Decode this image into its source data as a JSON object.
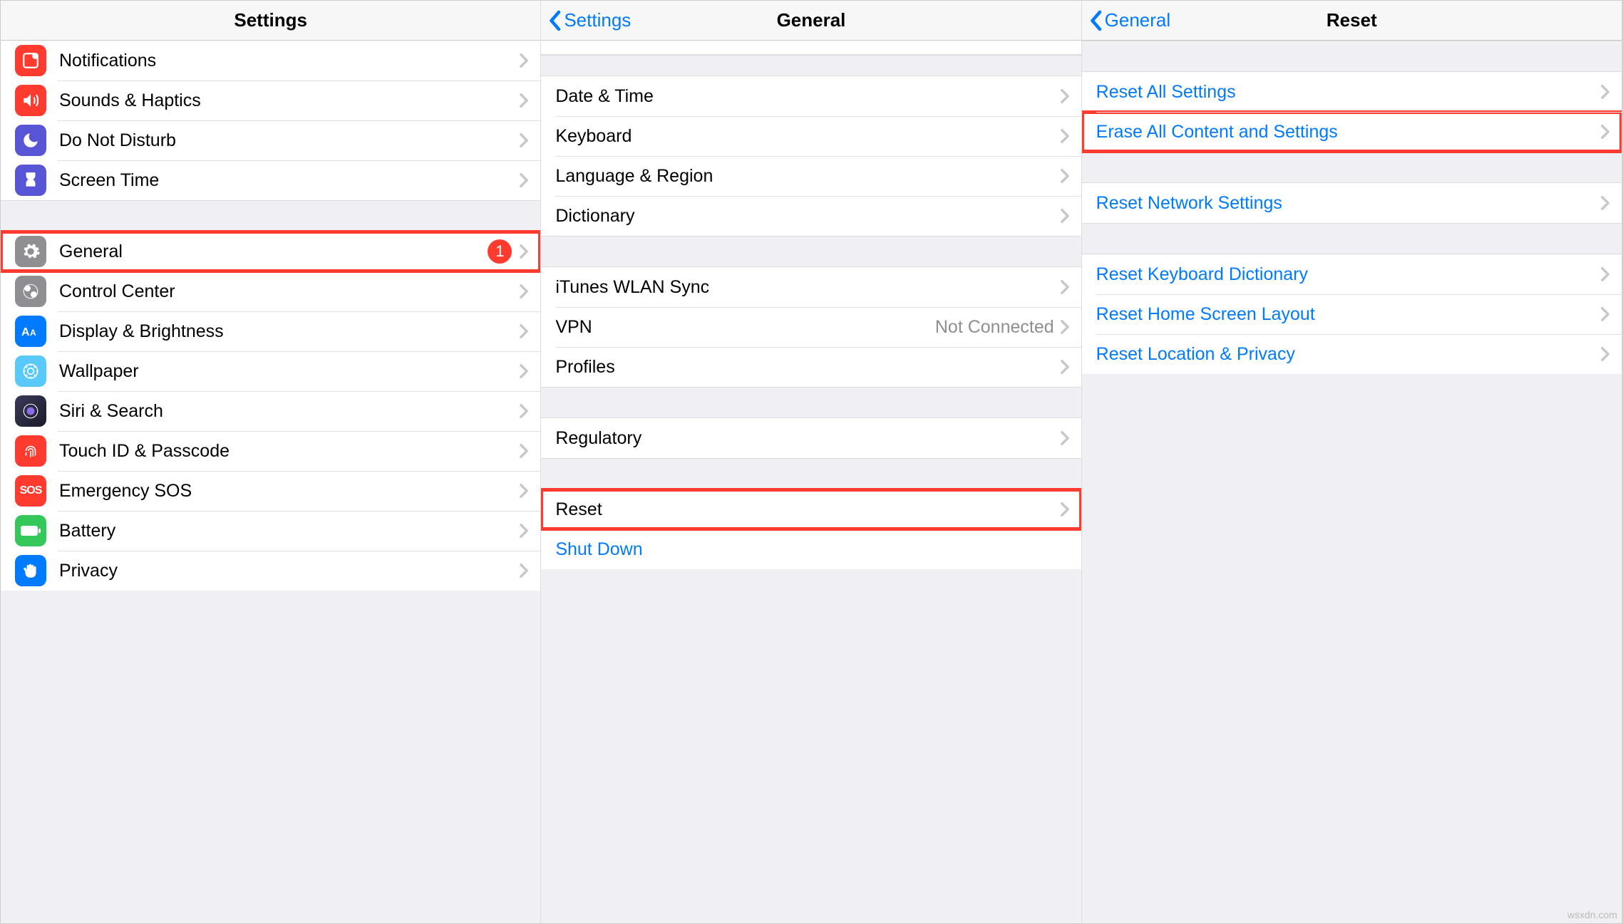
{
  "panel1": {
    "title": "Settings",
    "group1": [
      {
        "icon": "notifications-icon",
        "color": "ic-red",
        "label": "Notifications"
      },
      {
        "icon": "sounds-icon",
        "color": "ic-red",
        "label": "Sounds & Haptics"
      },
      {
        "icon": "dnd-icon",
        "color": "ic-purple",
        "label": "Do Not Disturb"
      },
      {
        "icon": "screentime-icon",
        "color": "ic-purple",
        "label": "Screen Time"
      }
    ],
    "group2": [
      {
        "icon": "general-icon",
        "color": "ic-gray",
        "label": "General",
        "badge": "1",
        "highlight": true
      },
      {
        "icon": "control-icon",
        "color": "ic-gray",
        "label": "Control Center"
      },
      {
        "icon": "display-icon",
        "color": "ic-blue",
        "label": "Display & Brightness"
      },
      {
        "icon": "wallpaper-icon",
        "color": "ic-cyan",
        "label": "Wallpaper"
      },
      {
        "icon": "siri-icon",
        "color": "ic-dark",
        "label": "Siri & Search"
      },
      {
        "icon": "touchid-icon",
        "color": "ic-red",
        "label": "Touch ID & Passcode"
      },
      {
        "icon": "sos-icon",
        "color": "ic-red",
        "label": "Emergency SOS"
      },
      {
        "icon": "battery-icon",
        "color": "ic-green",
        "label": "Battery"
      },
      {
        "icon": "privacy-icon",
        "color": "ic-blue",
        "label": "Privacy"
      }
    ]
  },
  "panel2": {
    "back": "Settings",
    "title": "General",
    "group1": [
      {
        "label": "Date & Time"
      },
      {
        "label": "Keyboard"
      },
      {
        "label": "Language & Region"
      },
      {
        "label": "Dictionary"
      }
    ],
    "group2": [
      {
        "label": "iTunes WLAN Sync"
      },
      {
        "label": "VPN",
        "detail": "Not Connected"
      },
      {
        "label": "Profiles"
      }
    ],
    "group3": [
      {
        "label": "Regulatory"
      }
    ],
    "group4": [
      {
        "label": "Reset",
        "highlight": true
      },
      {
        "label": "Shut Down",
        "link": true,
        "nochev": true
      }
    ]
  },
  "panel3": {
    "back": "General",
    "title": "Reset",
    "group1": [
      {
        "label": "Reset All Settings",
        "link": true
      },
      {
        "label": "Erase All Content and Settings",
        "link": true,
        "highlight": true
      }
    ],
    "group2": [
      {
        "label": "Reset Network Settings",
        "link": true
      }
    ],
    "group3": [
      {
        "label": "Reset Keyboard Dictionary",
        "link": true
      },
      {
        "label": "Reset Home Screen Layout",
        "link": true
      },
      {
        "label": "Reset Location & Privacy",
        "link": true
      }
    ]
  },
  "watermark": "wsxdn.com"
}
